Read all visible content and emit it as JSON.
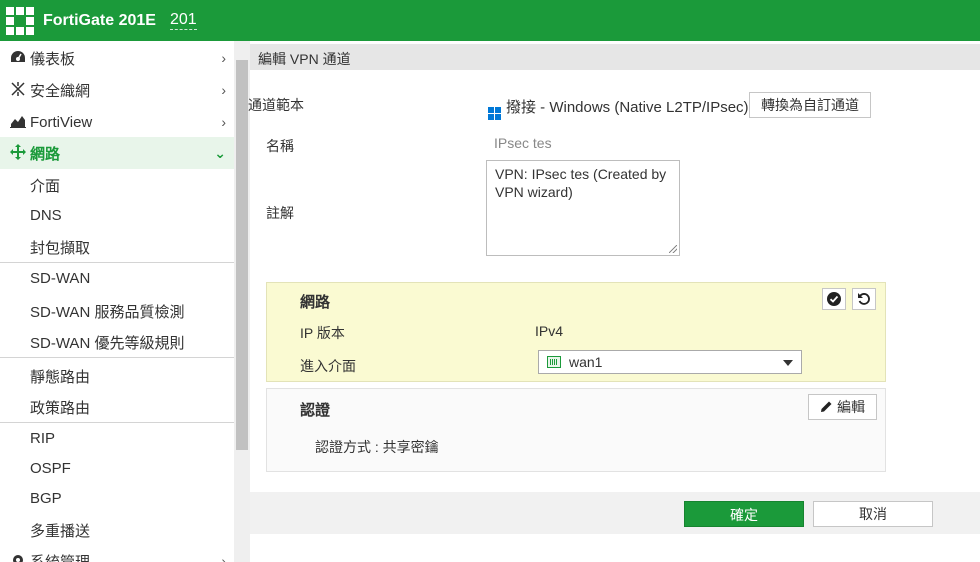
{
  "header": {
    "product": "FortiGate 201E",
    "hostname": "201",
    "brand_color": "#1b9a3a"
  },
  "sidebar": {
    "items": [
      {
        "label": "儀表板",
        "icon": "dashboard-icon"
      },
      {
        "label": "安全織網",
        "icon": "security-fabric-icon"
      },
      {
        "label": "FortiView",
        "icon": "fortiview-icon"
      },
      {
        "label": "網路",
        "icon": "network-icon",
        "active": true
      }
    ],
    "sub_items": [
      "介面",
      "DNS",
      "封包擷取",
      "SD-WAN",
      "SD-WAN 服務品質檢測",
      "SD-WAN 優先等級規則",
      "靜態路由",
      "政策路由",
      "RIP",
      "OSPF",
      "BGP",
      "多重播送"
    ],
    "partial_item": "系統管理"
  },
  "page": {
    "title": "編輯 VPN 通道"
  },
  "form": {
    "template_label": "通道範本",
    "template_value": "撥接 - Windows (Native L2TP/IPsec)",
    "convert_button": "轉換為自訂通道",
    "name_label": "名稱",
    "name_value": "IPsec tes",
    "comment_label": "註解",
    "comment_value": "VPN: IPsec tes (Created by VPN wizard)"
  },
  "network_panel": {
    "title": "網路",
    "ip_version_label": "IP 版本",
    "ip_version_value": "IPv4",
    "incoming_label": "進入介面",
    "incoming_value": "wan1"
  },
  "auth_panel": {
    "title": "認證",
    "edit_button": "編輯",
    "method_text": "認證方式 : 共享密鑰"
  },
  "footer": {
    "ok_label": "確定",
    "cancel_label": "取消"
  }
}
